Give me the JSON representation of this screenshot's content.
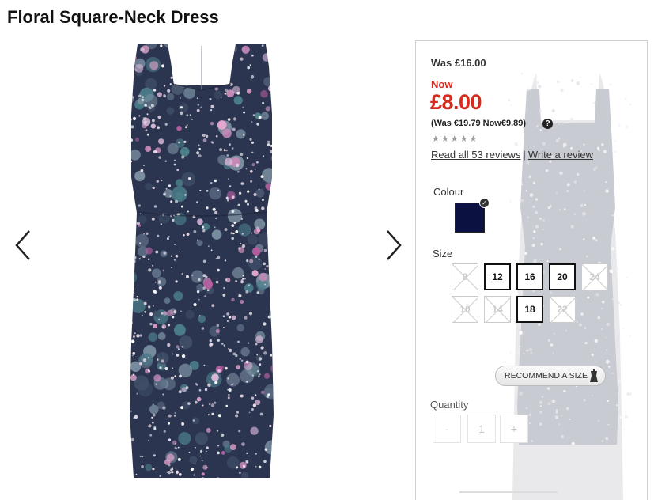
{
  "product": {
    "title": "Floral Square-Neck Dress"
  },
  "price": {
    "was": "Was £16.00",
    "now_label": "Now",
    "now": "£8.00",
    "euro": "(Was €19.79 Now€9.89)"
  },
  "rating": {
    "stars": "★★★★★",
    "stars_filled": 0,
    "stars_total": 5
  },
  "reviews": {
    "read": "Read all 53 reviews",
    "separator": "|",
    "write": "Write a review"
  },
  "colour": {
    "label": "Colour",
    "swatch_color": "#0b1242",
    "selected": true
  },
  "size": {
    "label": "Size",
    "options": [
      {
        "value": "8",
        "available": false
      },
      {
        "value": "12",
        "available": true
      },
      {
        "value": "16",
        "available": true
      },
      {
        "value": "20",
        "available": true
      },
      {
        "value": "24",
        "available": false
      },
      {
        "value": "10",
        "available": false
      },
      {
        "value": "14",
        "available": false
      },
      {
        "value": "18",
        "available": true
      },
      {
        "value": "22",
        "available": false
      }
    ]
  },
  "recommend": {
    "label": "RECOMMEND A SIZE"
  },
  "quantity": {
    "label": "Quantity",
    "minus": "-",
    "value": "1",
    "plus": "+"
  },
  "icons": {
    "prev": "chevron-left-icon",
    "next": "chevron-right-icon",
    "help": "question-circle-icon",
    "check": "check-icon",
    "mannequin": "mannequin-icon"
  },
  "colors": {
    "price_red": "#d52b1e",
    "dress_navy": "#2c3550",
    "blossom_pink": "#e7a6cf"
  }
}
